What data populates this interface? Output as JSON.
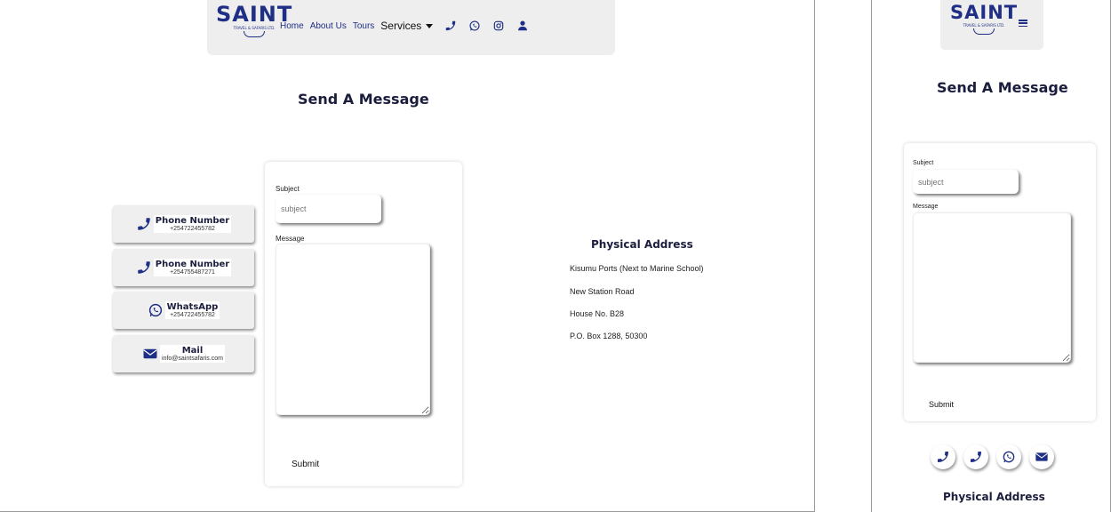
{
  "brand": {
    "name": "SAINT",
    "tagline": "TRAVEL & SAFARIS LTD."
  },
  "nav": {
    "home": "Home",
    "about": "About Us",
    "tours": "Tours",
    "services": "Services",
    "icons": [
      "phone-icon",
      "whatsapp-icon",
      "instagram-icon",
      "user-icon"
    ]
  },
  "heading": "Send A Message",
  "contacts": [
    {
      "title": "Phone Number",
      "value": "+254722455782",
      "icon": "phone-icon"
    },
    {
      "title": "Phone Number",
      "value": "+254755487271",
      "icon": "phone-icon"
    },
    {
      "title": "WhatsApp",
      "value": "+254722455782",
      "icon": "whatsapp-icon"
    },
    {
      "title": "Mail",
      "value": "info@saintsafaris.com",
      "icon": "mail-icon"
    }
  ],
  "form": {
    "subject_label": "Subject",
    "subject_placeholder": "subject",
    "message_label": "Message",
    "submit_label": "Submit"
  },
  "address": {
    "title": "Physical Address",
    "lines": [
      "Kisumu Ports (Next to Marine School)",
      "New Station Road",
      "House No. B28",
      "P.O. Box 1288, 50300"
    ]
  },
  "colors": {
    "brand": "#1f2f86",
    "heading": "#1b1d3d",
    "nav_bg": "#eeeeee"
  }
}
